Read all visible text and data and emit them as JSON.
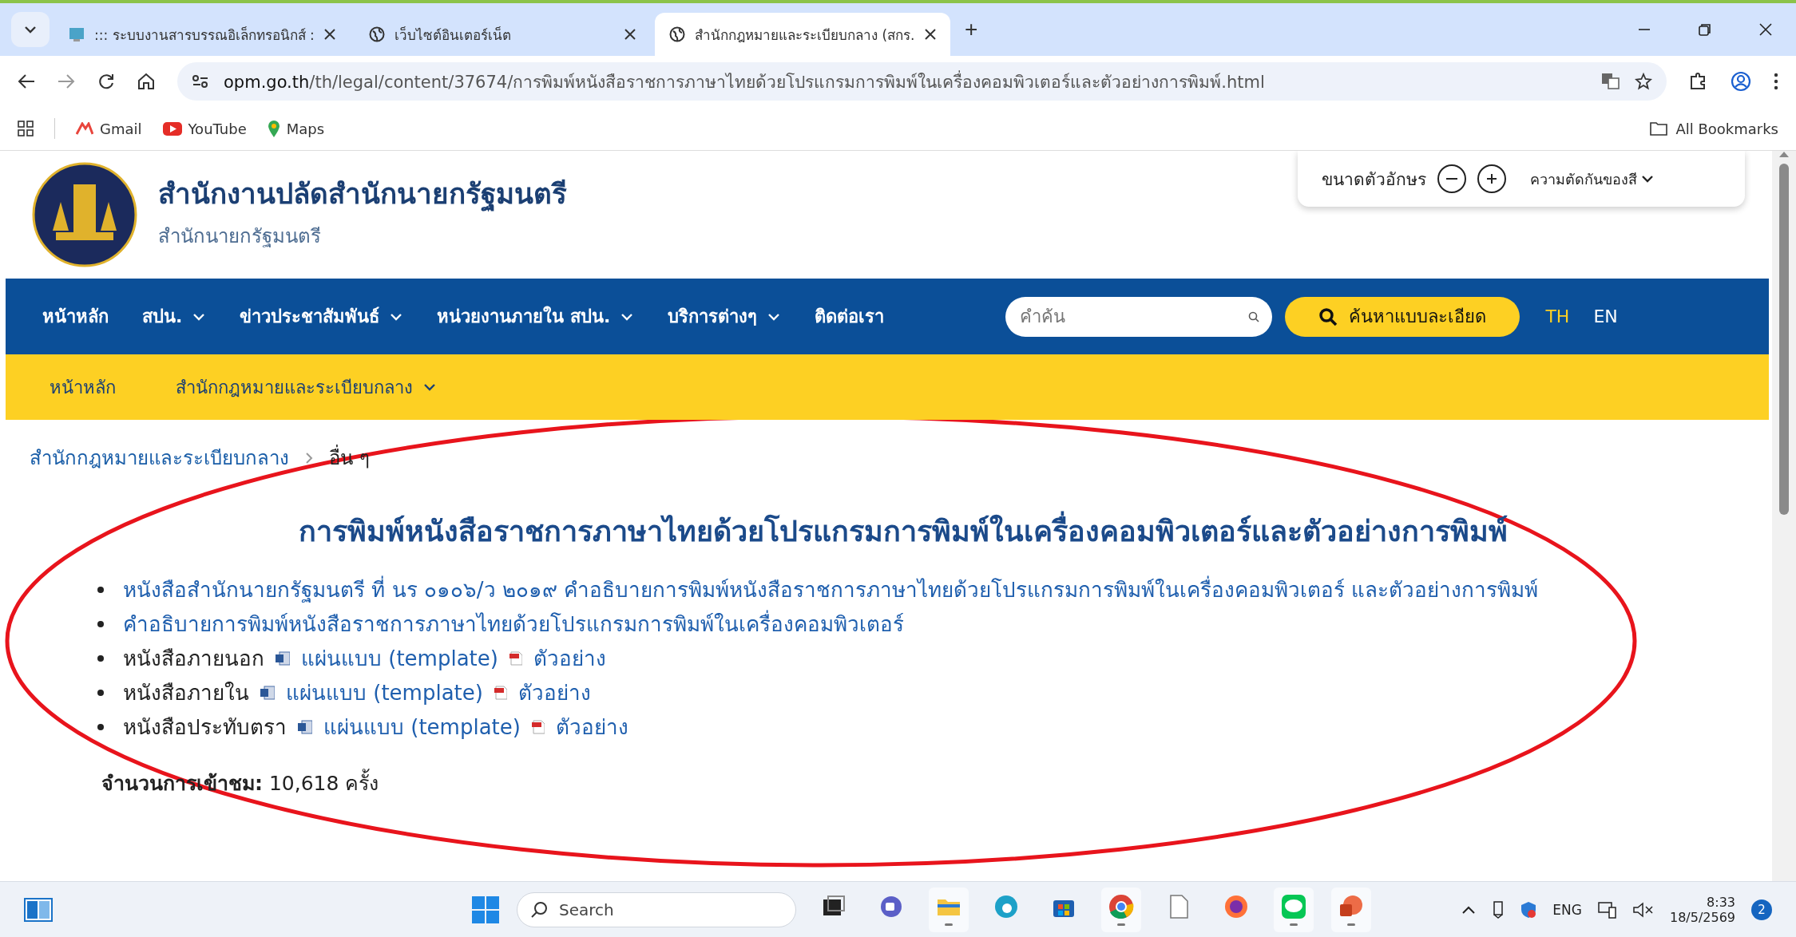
{
  "browser": {
    "tabs": [
      {
        "title": "::: ระบบงานสารบรรณอิเล็กทรอนิกส์ :",
        "kind": "app",
        "selected": false
      },
      {
        "title": "เว็บไซต์อินเตอร์เน็ต",
        "kind": "globe",
        "selected": false
      },
      {
        "title": "สำนักกฎหมายและระเบียบกลาง (สกร.",
        "kind": "globe",
        "selected": true
      }
    ],
    "new_tab": "+",
    "url_host": "opm.go.th",
    "url_path": "/th/legal/content/37674/การพิมพ์หนังสือราชการภาษาไทยด้วยโปรแกรมการพิมพ์ในเครื่องคอมพิวเตอร์และตัวอย่างการพิมพ์.html",
    "bookmarks": [
      {
        "label": "Gmail",
        "kind": "mail"
      },
      {
        "label": "YouTube",
        "kind": "video"
      },
      {
        "label": "Maps",
        "kind": "map"
      }
    ],
    "all_bookmarks": "All Bookmarks"
  },
  "site": {
    "title": "สำนักงานปลัดสำนักนายกรัฐมนตรี",
    "subtitle": "สำนักนายกรัฐมนตรี",
    "font_size_label": "ขนาดตัวอักษร",
    "contrast_label": "ความตัดกันของสี",
    "nav": [
      {
        "label": "หน้าหลัก",
        "dropdown": false
      },
      {
        "label": "สปน.",
        "dropdown": true
      },
      {
        "label": "ข่าวประชาสัมพันธ์",
        "dropdown": true
      },
      {
        "label": "หน่วยงานภายใน สปน.",
        "dropdown": true
      },
      {
        "label": "บริการต่างๆ",
        "dropdown": true
      },
      {
        "label": "ติดต่อเรา",
        "dropdown": false
      }
    ],
    "search_placeholder": "คำค้น",
    "advanced_search": "ค้นหาแบบละเอียด",
    "languages": [
      {
        "label": "TH",
        "selected": true
      },
      {
        "label": "EN",
        "selected": false
      }
    ],
    "subnav": [
      {
        "label": "หน้าหลัก",
        "dropdown": false
      },
      {
        "label": "สำนักกฎหมายและระเบียบกลาง",
        "dropdown": true
      }
    ],
    "breadcrumb": [
      {
        "label": "สำนักกฎหมายและระเบียบกลาง",
        "kind": "link"
      },
      {
        "label": "อื่น ๆ",
        "kind": "current"
      }
    ],
    "article_title": "การพิมพ์หนังสือราชการภาษาไทยด้วยโปรแกรมการพิมพ์ในเครื่องคอมพิวเตอร์และตัวอย่างการพิมพ์",
    "items": [
      {
        "kind": "link",
        "text": "หนังสือสำนักนายกรัฐมนตรี ที่ นร ๐๑๐๖/ว ๒๐๑๙ คำอธิบายการพิมพ์หนังสือราชการภาษาไทยด้วยโปรแกรมการพิมพ์ในเครื่องคอมพิวเตอร์ และตัวอย่างการพิมพ์"
      },
      {
        "kind": "link",
        "text": "คำอธิบายการพิมพ์หนังสือราชการภาษาไทยด้วยโปรแกรมการพิมพ์ในเครื่องคอมพิวเตอร์"
      },
      {
        "kind": "files",
        "label": "หนังสือภายนอก",
        "template": "แผ่นแบบ (template)",
        "sample": "ตัวอย่าง"
      },
      {
        "kind": "files",
        "label": "หนังสือภายใน",
        "template": "แผ่นแบบ (template)",
        "sample": "ตัวอย่าง"
      },
      {
        "kind": "files",
        "label": "หนังสือประทับตรา",
        "template": "แผ่นแบบ (template)",
        "sample": "ตัวอย่าง"
      }
    ],
    "views": "**จำนวนการเข้าชม:** 10,618 ครั้ง"
  },
  "taskbar": {
    "search_placeholder": "Search",
    "apps": [
      {
        "kind": "windows",
        "running": false
      },
      {
        "kind": "chat",
        "running": false
      },
      {
        "kind": "folder",
        "running": true
      },
      {
        "kind": "browser",
        "running": false
      },
      {
        "kind": "store",
        "running": false
      },
      {
        "kind": "chrome",
        "running": true
      },
      {
        "kind": "file",
        "running": false
      },
      {
        "kind": "fox",
        "running": false
      },
      {
        "kind": "line",
        "running": true
      },
      {
        "kind": "slides",
        "running": true
      }
    ],
    "language": "ENG",
    "time": "8:33",
    "date": "18/5/2569",
    "notifications": "2"
  }
}
